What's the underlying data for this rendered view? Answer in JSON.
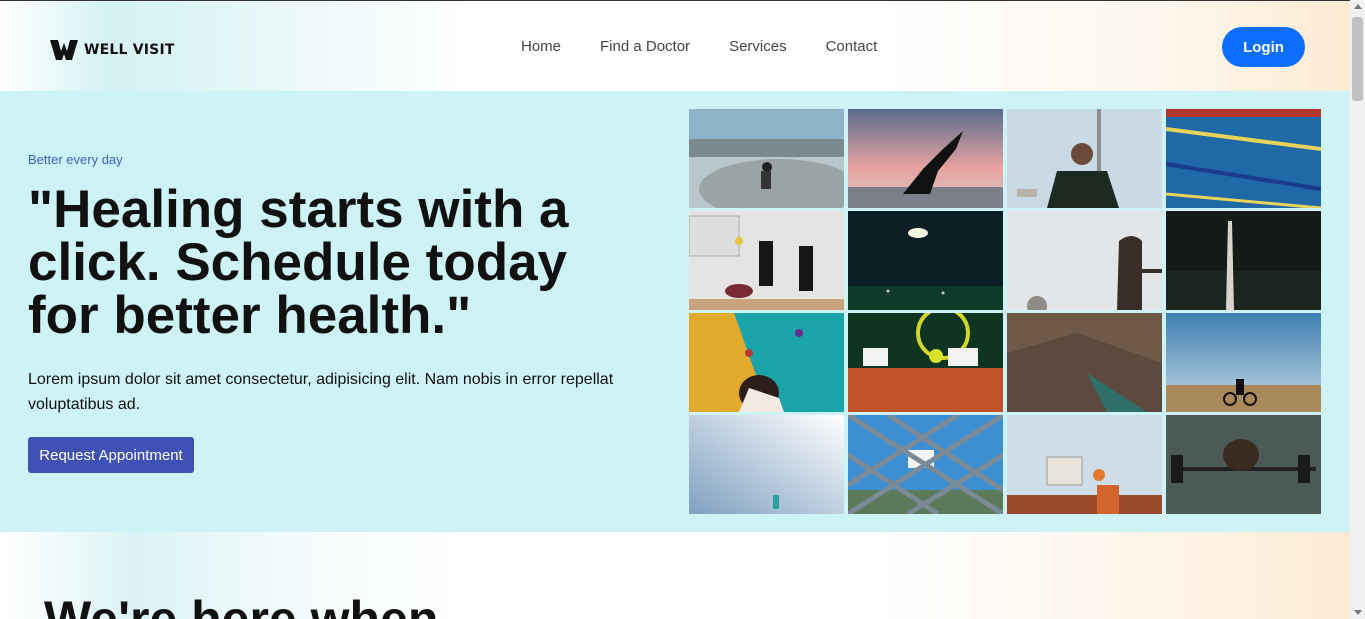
{
  "header": {
    "logo_text": "WELL VISIT",
    "nav": [
      "Home",
      "Find a Doctor",
      "Services",
      "Contact"
    ],
    "login_label": "Login"
  },
  "hero": {
    "tagline": "Better every day",
    "headline": "\"Healing starts with a click. Schedule today for better health.\"",
    "lead": "Lorem ipsum dolor sit amet consectetur, adipisicing elit. Nam nobis in error repellat voluptatibus ad.",
    "cta_label": "Request Appointment",
    "gallery": [
      "skatepark-photo",
      "yoga-sunset-photo",
      "soccer-player-photo",
      "swimming-pool-photo",
      "volleyball-photo",
      "night-field-photo",
      "basketball-hoop-photo",
      "dark-pole-photo",
      "climbing-wall-photo",
      "tennis-photo",
      "rock-climbing-photo",
      "cyclist-photo",
      "sky-photo",
      "chainlink-hoop-photo",
      "basketball-shot-photo",
      "weightlifting-photo"
    ]
  },
  "section2": {
    "title": "We're here when"
  },
  "colors": {
    "accent": "#0d6efd",
    "cta": "#3f51b5",
    "hero_bg": "#cdf3f6",
    "tagline": "#3b5fc0"
  }
}
